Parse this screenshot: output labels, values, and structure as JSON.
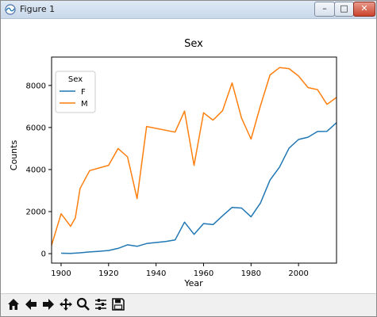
{
  "window": {
    "title": "Figure 1",
    "controls": {
      "minimize": "–",
      "maximize": "□",
      "close": "✕"
    }
  },
  "toolbar": {
    "tools": [
      {
        "name": "home-icon"
      },
      {
        "name": "back-arrow-icon"
      },
      {
        "name": "forward-arrow-icon"
      },
      {
        "name": "pan-icon"
      },
      {
        "name": "zoom-icon"
      },
      {
        "name": "subplots-config-icon"
      },
      {
        "name": "save-icon"
      }
    ]
  },
  "colors": {
    "F": "#1f77b4",
    "M": "#ff7f0e",
    "axes": "#000000",
    "window_frame": "#c9d8ea"
  },
  "chart_data": {
    "type": "line",
    "title": "Sex",
    "xlabel": "Year",
    "ylabel": "Counts",
    "xlim": [
      1896,
      2016
    ],
    "ylim": [
      -450,
      9350
    ],
    "xticks": [
      1900,
      1920,
      1940,
      1960,
      1980,
      2000
    ],
    "xtick_labels": [
      "1900",
      "1920",
      "1940",
      "1960",
      "1980",
      "2000"
    ],
    "yticks": [
      0,
      2000,
      4000,
      6000,
      8000
    ],
    "ytick_labels": [
      "0",
      "2000",
      "4000",
      "6000",
      "8000"
    ],
    "grid": false,
    "legend": {
      "title": "Sex",
      "placement": "upper-left",
      "entries": [
        "F",
        "M"
      ]
    },
    "series": [
      {
        "name": "F",
        "x": [
          1900,
          1904,
          1908,
          1912,
          1916,
          1920,
          1924,
          1928,
          1932,
          1936,
          1940,
          1944,
          1948,
          1952,
          1956,
          1960,
          1964,
          1968,
          1972,
          1976,
          1980,
          1984,
          1988,
          1992,
          1996,
          2000,
          2004,
          2008,
          2012,
          2016
        ],
        "y": [
          20,
          10,
          40,
          80,
          110,
          150,
          250,
          420,
          350,
          480,
          530,
          580,
          650,
          1500,
          920,
          1430,
          1380,
          1800,
          2200,
          2170,
          1750,
          2420,
          3500,
          4120,
          5020,
          5430,
          5540,
          5810,
          5820,
          6230
        ]
      },
      {
        "name": "M",
        "x": [
          1896,
          1900,
          1904,
          1906,
          1908,
          1912,
          1920,
          1924,
          1928,
          1932,
          1936,
          1948,
          1952,
          1956,
          1960,
          1964,
          1968,
          1972,
          1976,
          1980,
          1984,
          1988,
          1992,
          1996,
          2000,
          2004,
          2008,
          2012,
          2016
        ],
        "y": [
          400,
          1900,
          1300,
          1700,
          3100,
          3950,
          4200,
          5000,
          4600,
          2620,
          6050,
          5780,
          6780,
          4200,
          6700,
          6350,
          6800,
          8120,
          6450,
          5450,
          7050,
          8500,
          8850,
          8800,
          8450,
          7900,
          7800,
          7100,
          7430
        ]
      }
    ]
  }
}
